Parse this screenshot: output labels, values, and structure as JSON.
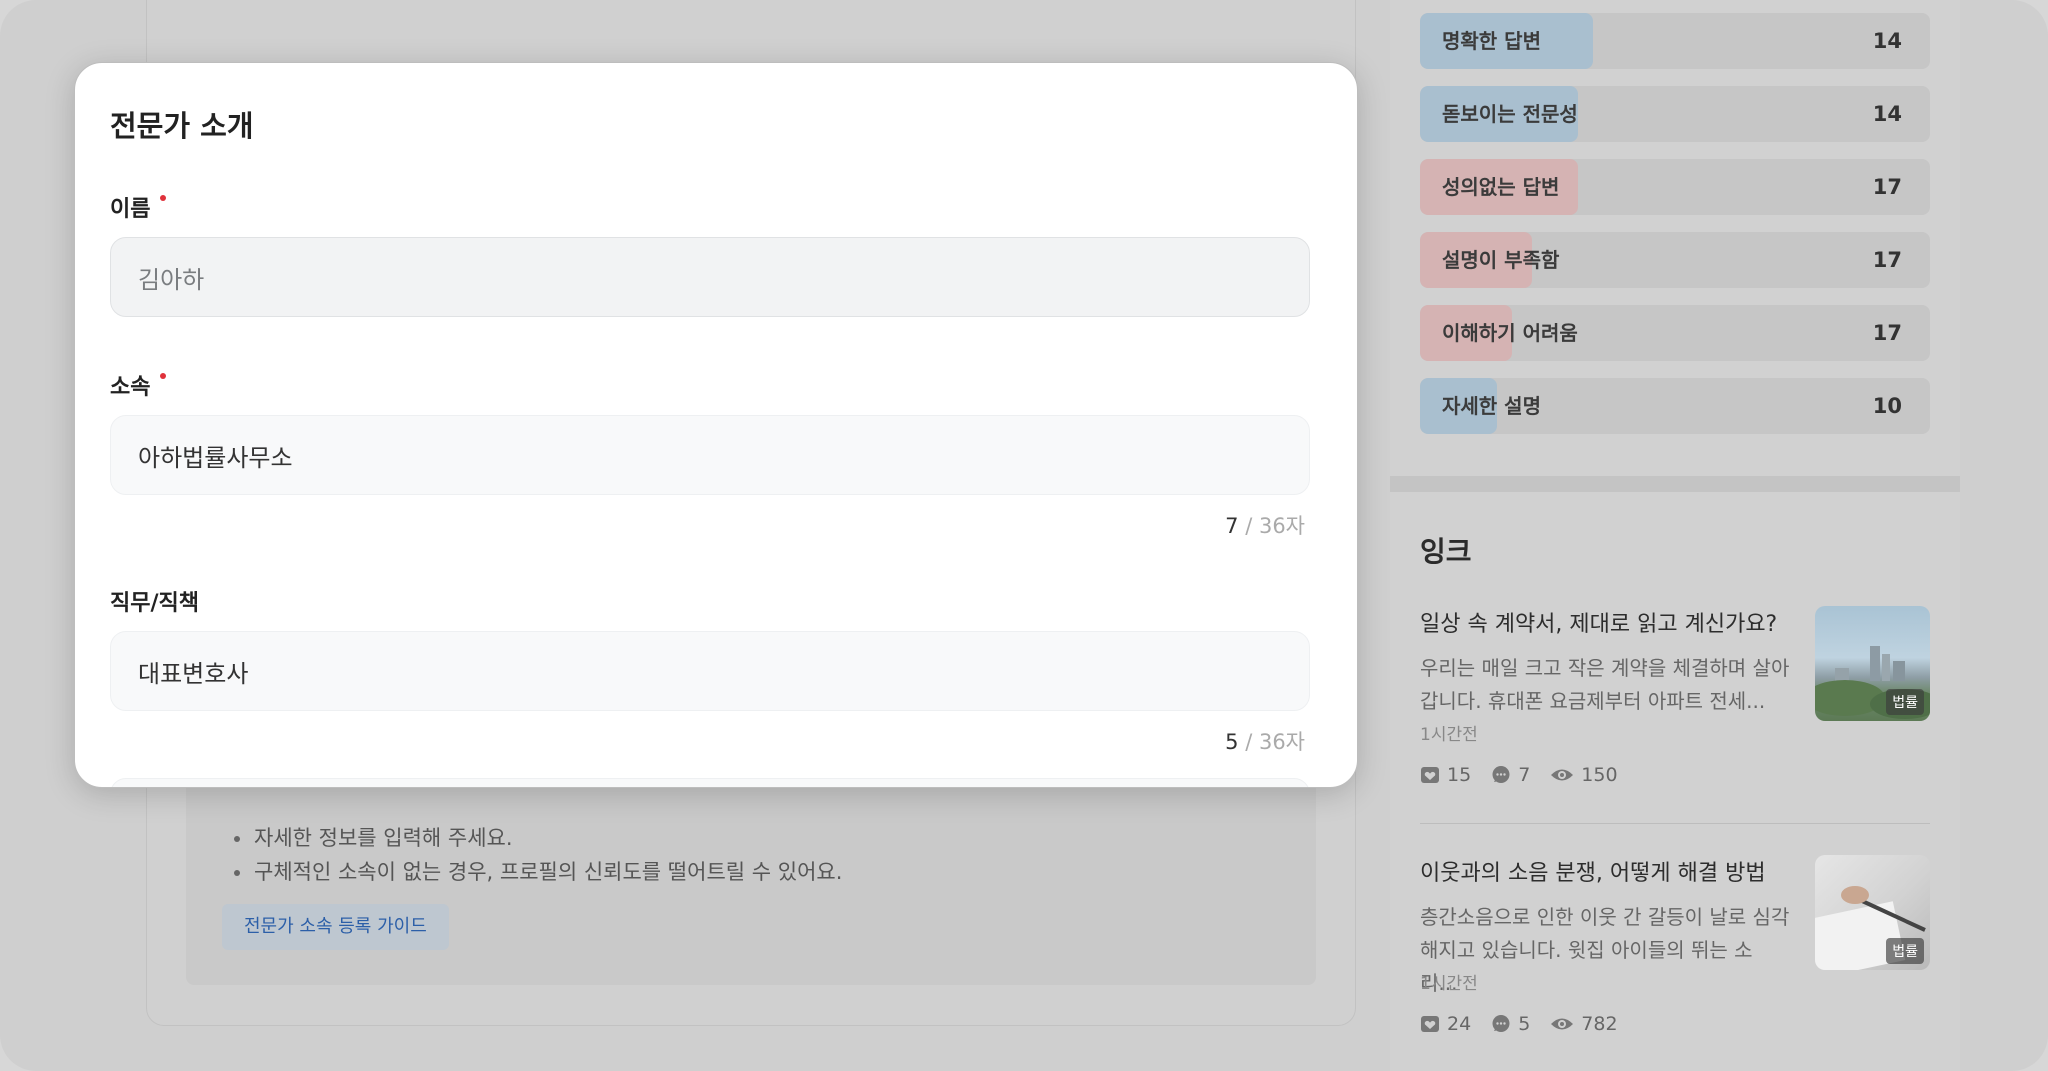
{
  "background": {
    "info_list": [
      "자세한 정보를 입력해 주세요.",
      "구체적인 소속이 없는 경우, 프로필의 신뢰도를 떨어트릴 수 있어요."
    ],
    "guide_button": "전문가 소속 등록 가이드",
    "rating_bars": [
      {
        "label": "명확한 답변",
        "count": "14",
        "fill_pct": 34,
        "color": "#a9bfcf"
      },
      {
        "label": "돋보이는 전문성",
        "count": "14",
        "fill_pct": 31,
        "color": "#a9bfcf"
      },
      {
        "label": "성의없는 답변",
        "count": "17",
        "fill_pct": 31,
        "color": "#d5b3b3"
      },
      {
        "label": "설명이 부족함",
        "count": "17",
        "fill_pct": 22,
        "color": "#d5b3b3"
      },
      {
        "label": "이해하기 어려움",
        "count": "17",
        "fill_pct": 18,
        "color": "#d5b3b3"
      },
      {
        "label": "자세한 설명",
        "count": "10",
        "fill_pct": 15,
        "color": "#a9bfcf"
      }
    ],
    "ink_section": {
      "title": "잉크",
      "articles": [
        {
          "title": "일상 속 계약서, 제대로 읽고 계신가요?",
          "desc": "우리는 매일 크고 작은 계약을 체결하며 살아갑니다. 휴대폰 요금제부터 아파트 전세...",
          "time": "1시간전",
          "likes": "15",
          "comments": "7",
          "views": "150",
          "badge": "법률"
        },
        {
          "title": "이웃과의 소음 분쟁, 어떻게 해결 방법",
          "desc": "층간소음으로 인한 이웃 간 갈등이 날로 심각해지고 있습니다. 윗집 아이들의 뛰는 소리...",
          "time": "1시간전",
          "likes": "24",
          "comments": "5",
          "views": "782",
          "badge": "법률"
        }
      ]
    }
  },
  "modal": {
    "title": "전문가 소개",
    "fields": {
      "name": {
        "label": "이름",
        "value": "김아하"
      },
      "affiliation": {
        "label": "소속",
        "value": "아하법률사무소",
        "count": "7",
        "max": " / 36자"
      },
      "position": {
        "label": "직무/직책",
        "value": "대표변호사",
        "count": "5",
        "max": " / 36자"
      }
    }
  }
}
